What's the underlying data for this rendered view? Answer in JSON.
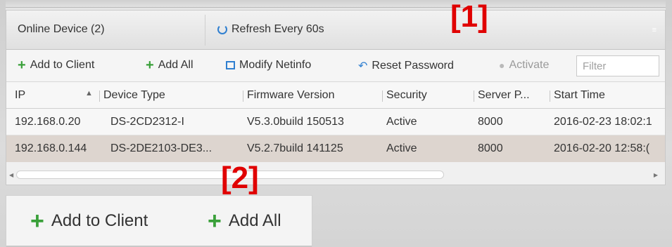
{
  "header": {
    "online_device": "Online Device (2)",
    "refresh": "Refresh Every 60s"
  },
  "toolbar": {
    "add_to_client": "Add to Client",
    "add_all": "Add All",
    "modify_netinfo": "Modify Netinfo",
    "reset_password": "Reset Password",
    "activate": "Activate",
    "filter_placeholder": "Filter"
  },
  "table": {
    "columns": [
      "IP",
      "Device Type",
      "Firmware Version",
      "Security",
      "Server P...",
      "Start Time"
    ],
    "rows": [
      [
        "192.168.0.20",
        "DS-2CD2312-I",
        "V5.3.0build 150513",
        "Active",
        "8000",
        "2016-02-23 18:02:1"
      ],
      [
        "192.168.0.144",
        "DS-2DE2103-DE3...",
        "V5.2.7build 141125",
        "Active",
        "8000",
        "2016-02-20 12:58:("
      ]
    ]
  },
  "markers": {
    "one": "[1]",
    "two": "[2]"
  },
  "zoom": {
    "add_to_client": "Add to Client",
    "add_all": "Add All"
  },
  "colors": {
    "marker": "#e00000",
    "plus": "#3aa03a",
    "accent": "#2f7fd0",
    "selected_row": "#ddd5cf"
  },
  "icons": [
    "refresh-icon",
    "collapse-icon",
    "plus-icon",
    "netinfo-icon",
    "reset-icon",
    "activate-icon",
    "sort-up-icon"
  ]
}
